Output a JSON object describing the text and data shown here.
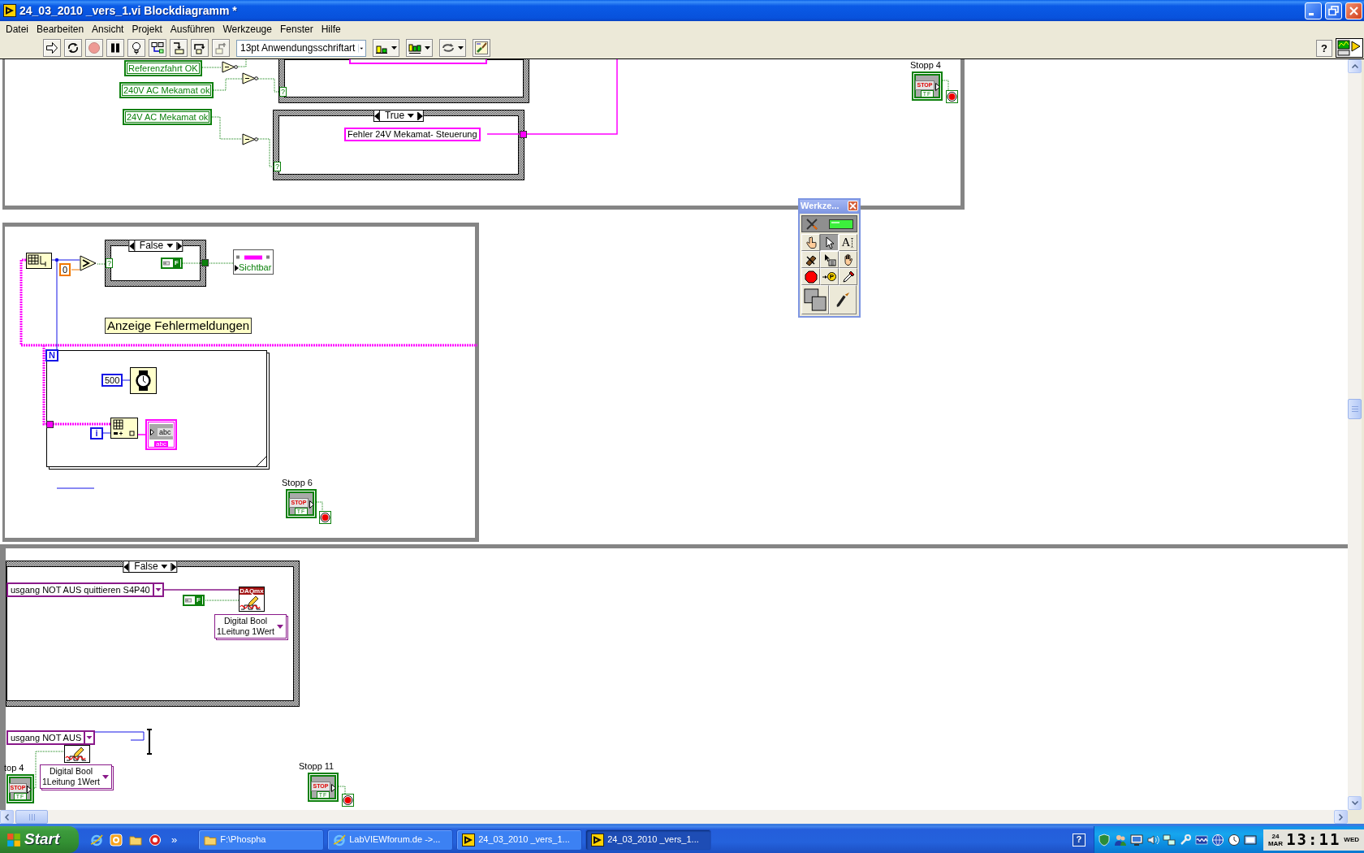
{
  "window": {
    "title": "24_03_2010 _vers_1.vi Blockdiagramm *"
  },
  "menu": [
    "Datei",
    "Bearbeiten",
    "Ansicht",
    "Projekt",
    "Ausführen",
    "Werkzeuge",
    "Fenster",
    "Hilfe"
  ],
  "toolbar": {
    "buttons": [
      {
        "kind": "run",
        "disabled": false
      },
      {
        "kind": "run-continuously",
        "disabled": false
      },
      {
        "kind": "abort",
        "disabled": true
      },
      {
        "kind": "pause",
        "disabled": false
      },
      {
        "kind": "highlight-execution",
        "disabled": false
      },
      {
        "kind": "retain-wire-values",
        "disabled": false
      },
      {
        "kind": "step-into",
        "disabled": false
      },
      {
        "kind": "step-over",
        "disabled": false
      },
      {
        "kind": "step-out",
        "disabled": true
      }
    ],
    "font": "13pt Anwendungsschriftart",
    "arrange": [
      {
        "kind": "align"
      },
      {
        "kind": "distribute"
      },
      {
        "kind": "reorder"
      },
      {
        "kind": "cleanup"
      }
    ],
    "help": "?"
  },
  "diagram": {
    "structures": [
      {
        "kind": "loop"
      },
      {
        "kind": "case"
      },
      {
        "kind": "case",
        "selector": "True"
      },
      {
        "kind": "loop"
      },
      {
        "kind": "case",
        "selector": "False"
      },
      {
        "kind": "for-loop",
        "count": "N"
      },
      {
        "kind": "loop"
      },
      {
        "kind": "case",
        "selector": "False"
      }
    ],
    "nodes": [
      {
        "kind": "bool-control",
        "text": "Referenzfahrt OK"
      },
      {
        "kind": "not-gate"
      },
      {
        "kind": "string-constant"
      },
      {
        "kind": "bool-control",
        "text": "240V AC Mekamat ok"
      },
      {
        "kind": "not-gate"
      },
      {
        "kind": "selector-terminal",
        "text": "?"
      },
      {
        "kind": "stop-control",
        "label": "Stopp 4",
        "text": "STOP",
        "type_label": "TF"
      },
      {
        "kind": "stop-terminal"
      },
      {
        "kind": "bool-control",
        "text": "24V AC Mekamat ok"
      },
      {
        "kind": "not-gate"
      },
      {
        "kind": "string-constant",
        "text": "Fehler 24V Mekamat- Steuerung"
      },
      {
        "kind": "string-tunnel"
      },
      {
        "kind": "selector-terminal",
        "text": "?"
      },
      {
        "kind": "array-node"
      },
      {
        "kind": "float-constant",
        "text": "0"
      },
      {
        "kind": "greater-gate"
      },
      {
        "kind": "selector-terminal",
        "text": "?"
      },
      {
        "kind": "bool-constant",
        "text": "F"
      },
      {
        "kind": "boolean-tunnel"
      },
      {
        "kind": "property-node",
        "text": "Sichtbar"
      },
      {
        "kind": "free-label",
        "text": "Anzeige Fehlermeldungen"
      },
      {
        "kind": "integer-constant",
        "text": "500"
      },
      {
        "kind": "wait-node"
      },
      {
        "kind": "string-tunnel"
      },
      {
        "kind": "iteration-terminal",
        "text": "i"
      },
      {
        "kind": "index-node"
      },
      {
        "kind": "string-indicator",
        "text": "abc",
        "type_label": "abc"
      },
      {
        "kind": "stop-control",
        "label": "Stopp 6",
        "text": "STOP",
        "type_label": "TF"
      },
      {
        "kind": "stop-terminal"
      },
      {
        "kind": "channel-constant",
        "text": "usgang NOT AUS quittieren S4P40"
      },
      {
        "kind": "bool-constant",
        "text": "F"
      },
      {
        "kind": "daqmx-write",
        "header": "DAQmx"
      },
      {
        "kind": "poly-selector",
        "lines": [
          "Digital Bool",
          "1Leitung 1Wert"
        ]
      },
      {
        "kind": "channel-constant",
        "text": "usgang NOT AUS"
      },
      {
        "kind": "daqmx-write"
      },
      {
        "kind": "stop-control",
        "label": "top 4",
        "text": "STOP",
        "type_label": "TF"
      },
      {
        "kind": "poly-selector",
        "lines": [
          "Digital Bool",
          "1Leitung 1Wert"
        ]
      },
      {
        "kind": "stop-control",
        "label": "Stopp 11",
        "text": "STOP",
        "type_label": "TF"
      },
      {
        "kind": "stop-terminal"
      }
    ]
  },
  "tools_palette": {
    "title": "Werkze...",
    "auto_select": true,
    "tools": [
      {
        "kind": "operate",
        "selected": false
      },
      {
        "kind": "position",
        "selected": true
      },
      {
        "kind": "text",
        "glyph": "A",
        "selected": false
      },
      {
        "kind": "wire",
        "selected": false
      },
      {
        "kind": "shortcut-menu",
        "selected": false
      },
      {
        "kind": "scroll",
        "selected": false
      },
      {
        "kind": "breakpoint",
        "selected": false
      },
      {
        "kind": "probe",
        "glyph": "P",
        "selected": false
      },
      {
        "kind": "color-copy",
        "selected": false
      }
    ],
    "color_tools": [
      {
        "kind": "color"
      },
      {
        "kind": "brush"
      }
    ]
  },
  "taskbar": {
    "start": "Start",
    "quick_launch": [
      {
        "kind": "browser"
      },
      {
        "kind": "media"
      },
      {
        "kind": "folder"
      },
      {
        "kind": "disc"
      }
    ],
    "more": "»",
    "tasks": [
      {
        "kind": "folder",
        "label": "F:\\Phospha",
        "selected": false
      },
      {
        "kind": "browser",
        "label": "LabVIEWforum.de ->...",
        "selected": false
      },
      {
        "kind": "labview",
        "label": "24_03_2010 _vers_1...",
        "selected": false
      },
      {
        "kind": "labview",
        "label": "24_03_2010 _vers_1...",
        "selected": true
      }
    ],
    "tray": [
      {
        "kind": "help",
        "text": "?"
      },
      {
        "kind": "shield"
      },
      {
        "kind": "users"
      },
      {
        "kind": "monitor"
      },
      {
        "kind": "speaker"
      },
      {
        "kind": "network"
      },
      {
        "kind": "wrench"
      },
      {
        "kind": "wave"
      },
      {
        "kind": "globe"
      },
      {
        "kind": "clock"
      },
      {
        "kind": "window"
      }
    ],
    "clock": {
      "day": "24",
      "month": "MAR",
      "time": "13:11",
      "weekday": "WED"
    }
  }
}
